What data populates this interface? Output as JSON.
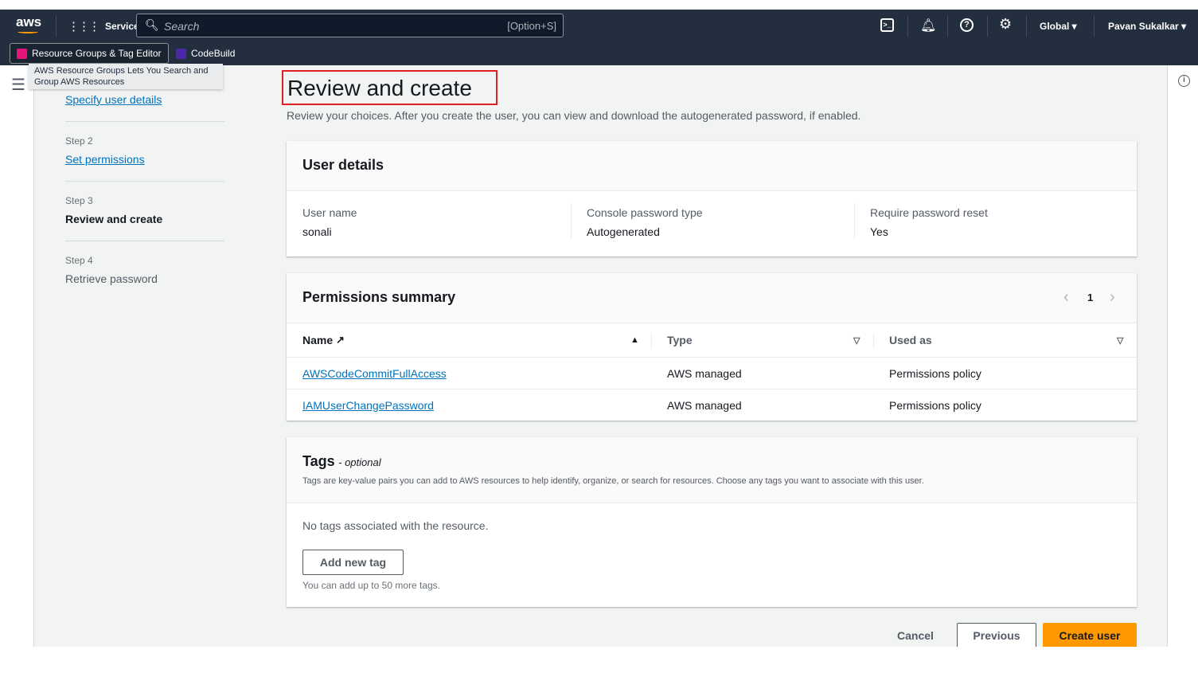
{
  "topnav": {
    "logo": "aws",
    "services": "Services",
    "search_placeholder": "Search",
    "search_shortcut": "[Option+S]",
    "region": "Global",
    "user": "Pavan Sukalkar",
    "favorites": [
      {
        "label": "Resource Groups & Tag Editor",
        "color": "#e7157b"
      },
      {
        "label": "CodeBuild",
        "color": "#4d27aa"
      }
    ],
    "tooltip": "AWS Resource Groups Lets You Search and Group AWS Resources"
  },
  "steps": [
    {
      "label": "Specify user details",
      "state": "link"
    },
    {
      "num": "Step 2",
      "label": "Set permissions",
      "state": "link"
    },
    {
      "num": "Step 3",
      "label": "Review and create",
      "state": "current"
    },
    {
      "num": "Step 4",
      "label": "Retrieve password",
      "state": "disabled"
    }
  ],
  "page": {
    "title": "Review and create",
    "description": "Review your choices. After you create the user, you can view and download the autogenerated password, if enabled."
  },
  "user_details": {
    "title": "User details",
    "fields": [
      {
        "label": "User name",
        "value": "sonali"
      },
      {
        "label": "Console password type",
        "value": "Autogenerated"
      },
      {
        "label": "Require password reset",
        "value": "Yes"
      }
    ]
  },
  "permissions": {
    "title": "Permissions summary",
    "page": "1",
    "columns": [
      "Name",
      "Type",
      "Used as"
    ],
    "rows": [
      {
        "name": "AWSCodeCommitFullAccess",
        "type": "AWS managed",
        "used_as": "Permissions policy"
      },
      {
        "name": "IAMUserChangePassword",
        "type": "AWS managed",
        "used_as": "Permissions policy"
      }
    ]
  },
  "tags": {
    "title": "Tags",
    "optional": "- optional",
    "description": "Tags are key-value pairs you can add to AWS resources to help identify, organize, or search for resources. Choose any tags you want to associate with this user.",
    "empty": "No tags associated with the resource.",
    "add_button": "Add new tag",
    "hint": "You can add up to 50 more tags."
  },
  "actions": {
    "cancel": "Cancel",
    "previous": "Previous",
    "create": "Create user"
  },
  "colors": {
    "nav": "#232f3e",
    "primary": "#ff9900",
    "link": "#0073bb",
    "highlight": "#e02020"
  }
}
